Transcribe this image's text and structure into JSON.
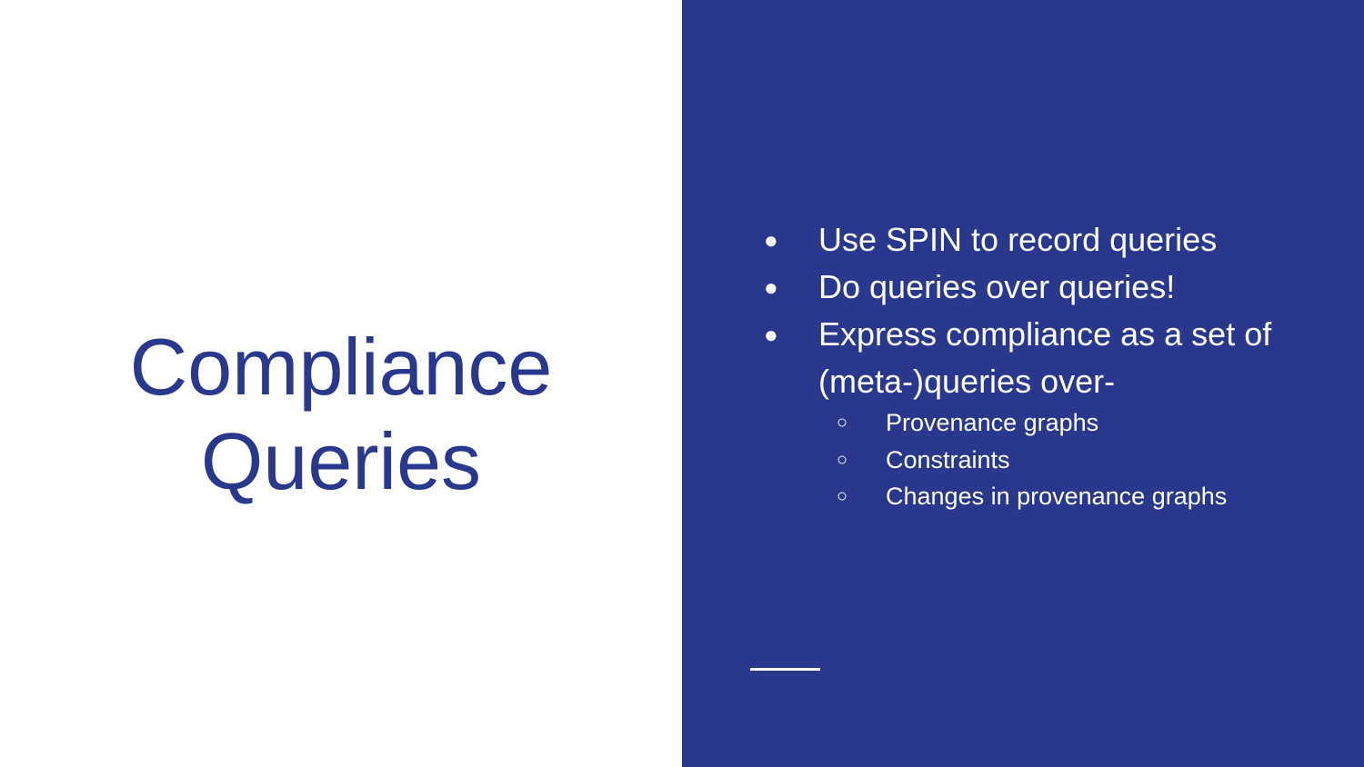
{
  "slide": {
    "title_lines": [
      "Compliance",
      "Queries"
    ],
    "bullets": [
      "Use SPIN to record queries",
      "Do queries over queries!",
      "Express compliance as a set of (meta-)queries over-"
    ],
    "sub_bullets": [
      "Provenance graphs",
      "Constraints",
      "Changes in provenance graphs"
    ],
    "bullet_marker": "●",
    "sub_bullet_marker": "○"
  },
  "colors": {
    "primary": "#29388d",
    "background": "#ffffff",
    "text_on_primary": "#ffffff"
  }
}
